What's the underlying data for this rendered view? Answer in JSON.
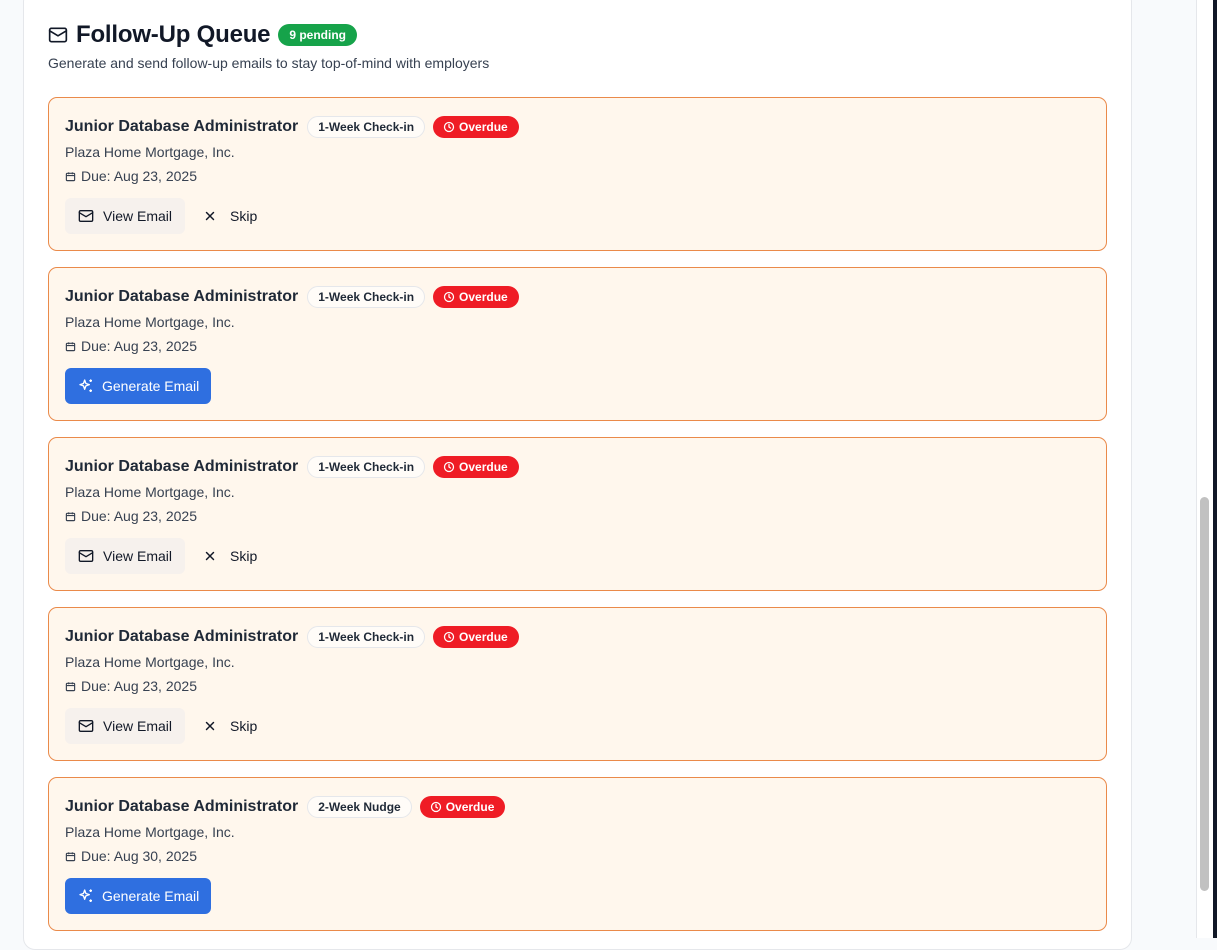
{
  "queue": {
    "title": "Follow-Up Queue",
    "pending_label": "9 pending",
    "subtitle": "Generate and send follow-up emails to stay top-of-mind with employers"
  },
  "colors": {
    "pending_badge": "#16a34a",
    "overdue_badge": "#ef1c25",
    "card_bg": "#fff7ed",
    "card_border": "#ea8a4a",
    "primary_button": "#2f6fe0"
  },
  "actions": {
    "view_email": "View Email",
    "skip": "Skip",
    "generate_email": "Generate Email"
  },
  "items": [
    {
      "title": "Junior Database Administrator",
      "type": "1-Week Check-in",
      "status": "Overdue",
      "company": "Plaza Home Mortgage, Inc.",
      "due": "Due: Aug 23, 2025",
      "mode": "view"
    },
    {
      "title": "Junior Database Administrator",
      "type": "1-Week Check-in",
      "status": "Overdue",
      "company": "Plaza Home Mortgage, Inc.",
      "due": "Due: Aug 23, 2025",
      "mode": "generate"
    },
    {
      "title": "Junior Database Administrator",
      "type": "1-Week Check-in",
      "status": "Overdue",
      "company": "Plaza Home Mortgage, Inc.",
      "due": "Due: Aug 23, 2025",
      "mode": "view"
    },
    {
      "title": "Junior Database Administrator",
      "type": "1-Week Check-in",
      "status": "Overdue",
      "company": "Plaza Home Mortgage, Inc.",
      "due": "Due: Aug 23, 2025",
      "mode": "view"
    },
    {
      "title": "Junior Database Administrator",
      "type": "2-Week Nudge",
      "status": "Overdue",
      "company": "Plaza Home Mortgage, Inc.",
      "due": "Due: Aug 30, 2025",
      "mode": "generate"
    }
  ]
}
